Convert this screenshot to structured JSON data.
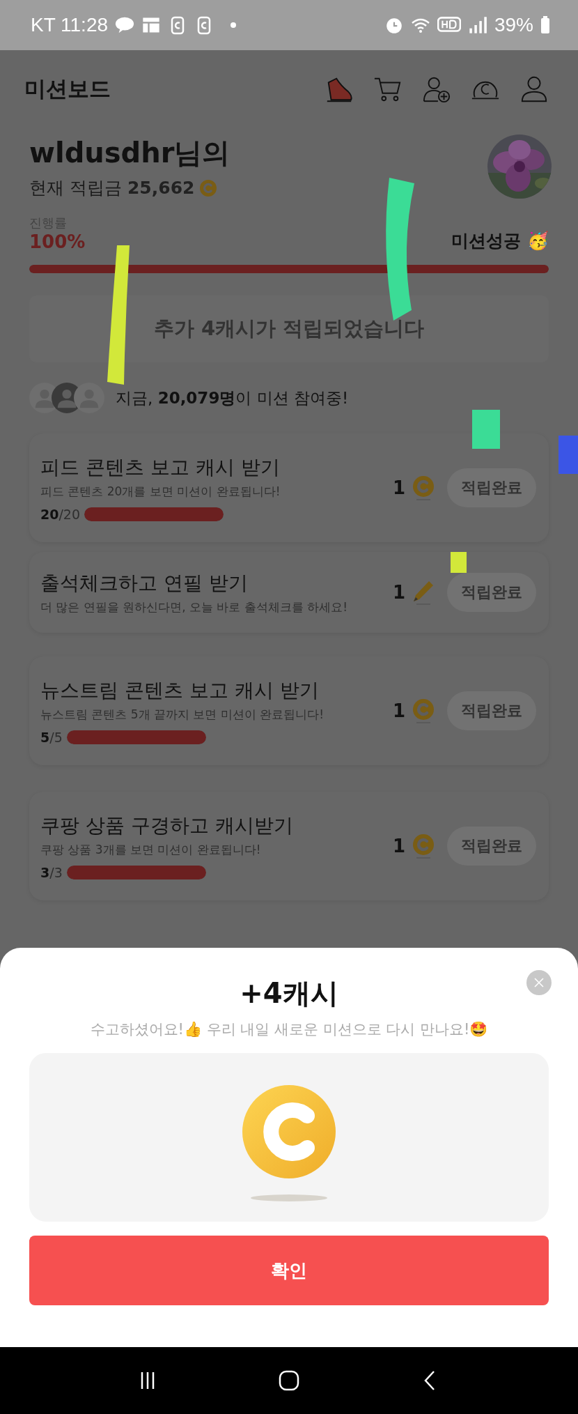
{
  "status_bar": {
    "carrier": "KT",
    "time": "11:28",
    "battery": "39%"
  },
  "header": {
    "title": "미션보드"
  },
  "profile": {
    "name": "wldusdhr님의",
    "balance_label": "현재 적립금",
    "balance": "25,662"
  },
  "progress": {
    "label": "진행률",
    "percent": "100%",
    "level": 1,
    "status": "미션성공 🥳"
  },
  "banner": "추가 4캐시가 적립되었습니다",
  "participants": "지금, **20,079명**이 미션 참여중!",
  "missions": [
    {
      "title": "피드 콘텐츠 보고 캐시 받기",
      "description": "피드 콘텐츠 20개를 보면 미션이 완료됩니다!",
      "kind": "coin",
      "reward": "1",
      "count": "**20**/20",
      "level": 1,
      "button": "적립완료"
    },
    {
      "title": "출석체크하고 연필 받기",
      "description": "더 많은 연필을 원하신다면, 오늘 바로 출석체크를 하세요!",
      "kind": "pencil",
      "reward": "1",
      "button": "적립완료"
    },
    {
      "title": "뉴스트림 콘텐츠 보고 캐시 받기",
      "description": "뉴스트림 콘텐츠 5개 끝까지 보면 미션이 완료됩니다!",
      "kind": "coin",
      "reward": "1",
      "count": "**5**/5",
      "level": 1,
      "button": "적립완료"
    },
    {
      "title": "쿠팡 상품 구경하고 캐시받기",
      "description": "쿠팡 상품 3개를 보면 미션이 완료됩니다!",
      "kind": "coin",
      "reward": "1",
      "count": "**3**/3",
      "level": 1,
      "button": "적립완료"
    }
  ],
  "modal": {
    "title": "+4캐시",
    "message": "수고하셨어요!👍 우리 내일 새로운 미션으로 다시 만나요!🤩",
    "button": "확인"
  }
}
